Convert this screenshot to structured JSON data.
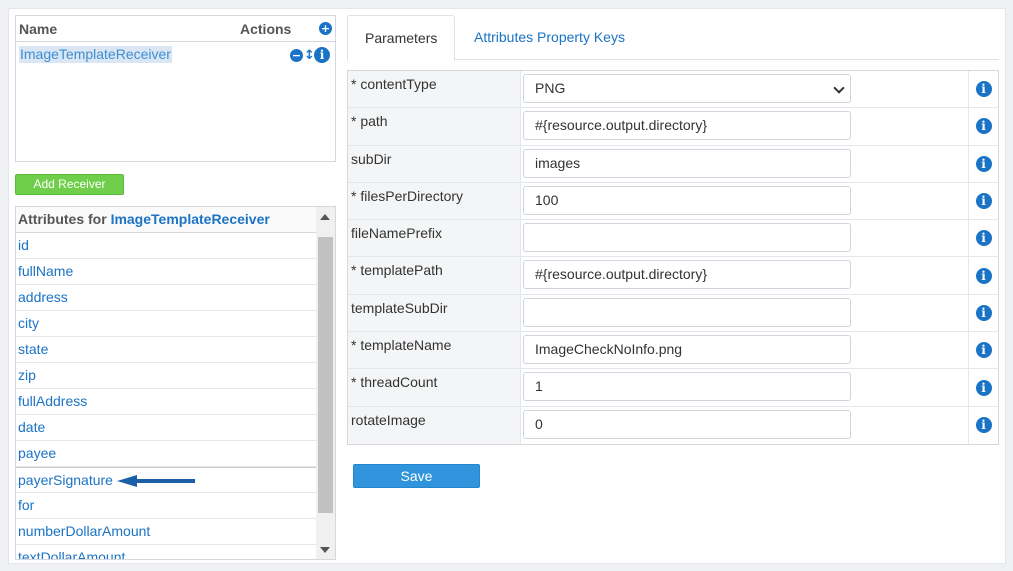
{
  "receivers": {
    "header_name": "Name",
    "header_actions": "Actions",
    "add_icon": "plus-circle-icon",
    "items": [
      {
        "name": "ImageTemplateReceiver"
      }
    ]
  },
  "add_receiver_label": "Add Receiver",
  "attributes": {
    "header_prefix": "Attributes for ",
    "header_receiver": "ImageTemplateReceiver",
    "items": [
      "id",
      "fullName",
      "address",
      "city",
      "state",
      "zip",
      "fullAddress",
      "date",
      "payee",
      "payerSignature",
      "for",
      "numberDollarAmount",
      "textDollarAmount"
    ],
    "highlighted": "payerSignature"
  },
  "tabs": [
    {
      "label": "Parameters",
      "active": true
    },
    {
      "label": "Attributes Property Keys",
      "active": false
    }
  ],
  "params": [
    {
      "label": "* contentType",
      "value": "PNG",
      "type": "select"
    },
    {
      "label": "* path",
      "value": "#{resource.output.directory}",
      "type": "input"
    },
    {
      "label": "subDir",
      "value": "images",
      "type": "input"
    },
    {
      "label": "* filesPerDirectory",
      "value": "100",
      "type": "input"
    },
    {
      "label": "fileNamePrefix",
      "value": "",
      "type": "input"
    },
    {
      "label": "* templatePath",
      "value": "#{resource.output.directory}",
      "type": "input"
    },
    {
      "label": "templateSubDir",
      "value": "",
      "type": "input"
    },
    {
      "label": "* templateName",
      "value": "ImageCheckNoInfo.png",
      "type": "input"
    },
    {
      "label": "* threadCount",
      "value": "1",
      "type": "input"
    },
    {
      "label": "rotateImage",
      "value": "0",
      "type": "input"
    }
  ],
  "save_label": "Save",
  "colors": {
    "accent": "#1a73c5",
    "add_button": "#6fcf4a",
    "save_button": "#2f94dc"
  }
}
